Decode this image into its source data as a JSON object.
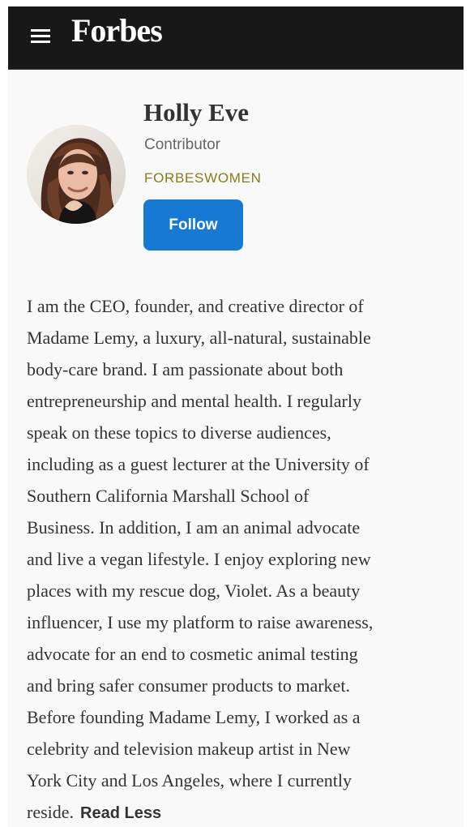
{
  "header": {
    "logo_text": "Forbes",
    "menu_icon": "hamburger-icon",
    "background_color": "#181818"
  },
  "author": {
    "name": "Holly Eve",
    "role": "Contributor",
    "channel": "FORBESWOMEN",
    "follow_label": "Follow",
    "accent_color": "#1679d3",
    "channel_color": "#8a7b18"
  },
  "bio": {
    "lines": [
      "I am the CEO, founder, and creative director of",
      "Madame Lemy, a luxury, all-natural, sustainable",
      "body-care brand. I am passionate about both",
      "entrepreneurship and mental health. I regularly",
      "speak on these topics to diverse audiences,",
      "including as a guest lecturer at the University of",
      "Southern California Marshall School of",
      "Business. In addition, I am an animal advocate",
      "and live a vegan lifestyle. I enjoy exploring new",
      "places with my rescue dog, Violet. As a beauty",
      "influencer, I use my platform to raise awareness,",
      "advocate for an end to cosmetic animal testing",
      "and bring safer consumer products to market.",
      "Before founding Madame Lemy, I worked as a",
      "celebrity and television makeup artist in New",
      "York City and Los Angeles, where I currently",
      "reside."
    ],
    "read_less": "Read Less"
  }
}
